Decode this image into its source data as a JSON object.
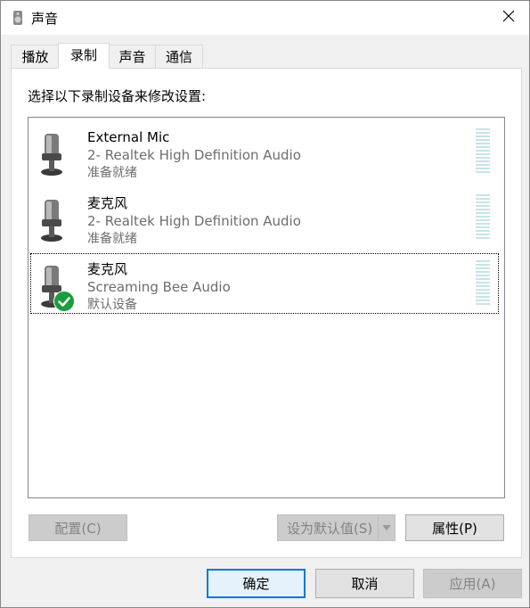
{
  "window": {
    "title": "声音",
    "icon": "speaker-icon",
    "close_icon": "close-icon"
  },
  "tabs": [
    {
      "label": "播放",
      "active": false
    },
    {
      "label": "录制",
      "active": true
    },
    {
      "label": "声音",
      "active": false
    },
    {
      "label": "通信",
      "active": false
    }
  ],
  "panel": {
    "instructions": "选择以下录制设备来修改设置:",
    "devices": [
      {
        "name": "External Mic",
        "driver": "2- Realtek High Definition Audio",
        "status": "准备就绪",
        "is_default": false,
        "selected": false,
        "icon": "microphone-icon"
      },
      {
        "name": "麦克风",
        "driver": "2- Realtek High Definition Audio",
        "status": "准备就绪",
        "is_default": false,
        "selected": false,
        "icon": "microphone-icon"
      },
      {
        "name": "麦克风",
        "driver": "Screaming Bee Audio",
        "status": "默认设备",
        "is_default": true,
        "selected": true,
        "icon": "microphone-icon",
        "badge_icon": "green-checkmark-icon"
      }
    ],
    "buttons": {
      "configure": "配置(C)",
      "set_default": "设为默认值(S)",
      "properties": "属性(P)"
    }
  },
  "footer": {
    "ok": "确定",
    "cancel": "取消",
    "apply": "应用(A)"
  },
  "colors": {
    "meter_level": "#c7e3ea",
    "default_badge": "#1a9d3a",
    "focus_border": "#0078d7"
  }
}
